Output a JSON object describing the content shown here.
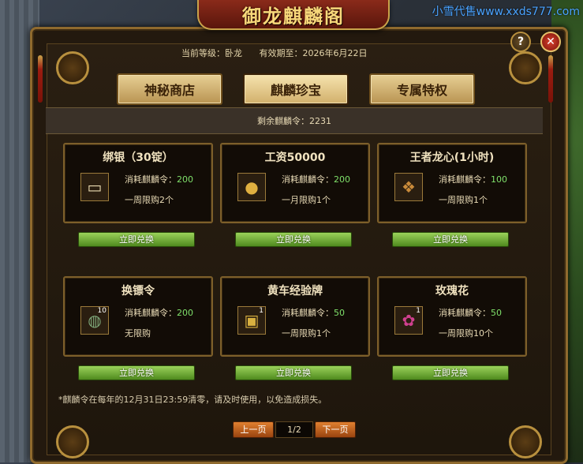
{
  "watermark": "小雪代售www.xxds777.com",
  "window": {
    "title": "御龙麒麟阁",
    "help_label": "?",
    "close_label": "✕"
  },
  "info": {
    "level": "当前等级：卧龙",
    "expiry": "有效期至：2026年6月22日"
  },
  "tabs": [
    {
      "label": "神秘商店",
      "active": false
    },
    {
      "label": "麒麟珍宝",
      "active": true
    },
    {
      "label": "专属特权",
      "active": false
    }
  ],
  "remaining": "剩余麒麟令：2231",
  "items": [
    {
      "name": "绑银（30锭）",
      "icon": "silver-ingot-icon",
      "icon_glyph": "▭",
      "count": "",
      "cost_label": "消耗麒麟令：",
      "cost": "200",
      "limit": "一周限购2个",
      "button": "立即兑换"
    },
    {
      "name": "工资50000",
      "icon": "gold-coins-icon",
      "icon_glyph": "●",
      "count": "",
      "cost_label": "消耗麒麟令：",
      "cost": "200",
      "limit": "一月限购1个",
      "button": "立即兑换"
    },
    {
      "name": "王者龙心(1小时)",
      "icon": "dragon-heart-icon",
      "icon_glyph": "❖",
      "count": "",
      "cost_label": "消耗麒麟令：",
      "cost": "100",
      "limit": "一周限购1个",
      "button": "立即兑换"
    },
    {
      "name": "换镖令",
      "icon": "escort-token-icon",
      "icon_glyph": "◍",
      "count": "10",
      "cost_label": "消耗麒麟令：",
      "cost": "200",
      "limit": "无限购",
      "button": "立即兑换"
    },
    {
      "name": "黄车经验牌",
      "icon": "yellow-cart-icon",
      "icon_glyph": "▣",
      "count": "1",
      "cost_label": "消耗麒麟令：",
      "cost": "50",
      "limit": "一周限购1个",
      "button": "立即兑换"
    },
    {
      "name": "玫瑰花",
      "icon": "rose-icon",
      "icon_glyph": "✿",
      "count": "1",
      "cost_label": "消耗麒麟令：",
      "cost": "50",
      "limit": "一周限购10个",
      "button": "立即兑换"
    }
  ],
  "note": "*麒麟令在每年的12月31日23:59清零，请及时使用，以免造成损失。",
  "pager": {
    "prev": "上一页",
    "page": "1/2",
    "next": "下一页"
  }
}
